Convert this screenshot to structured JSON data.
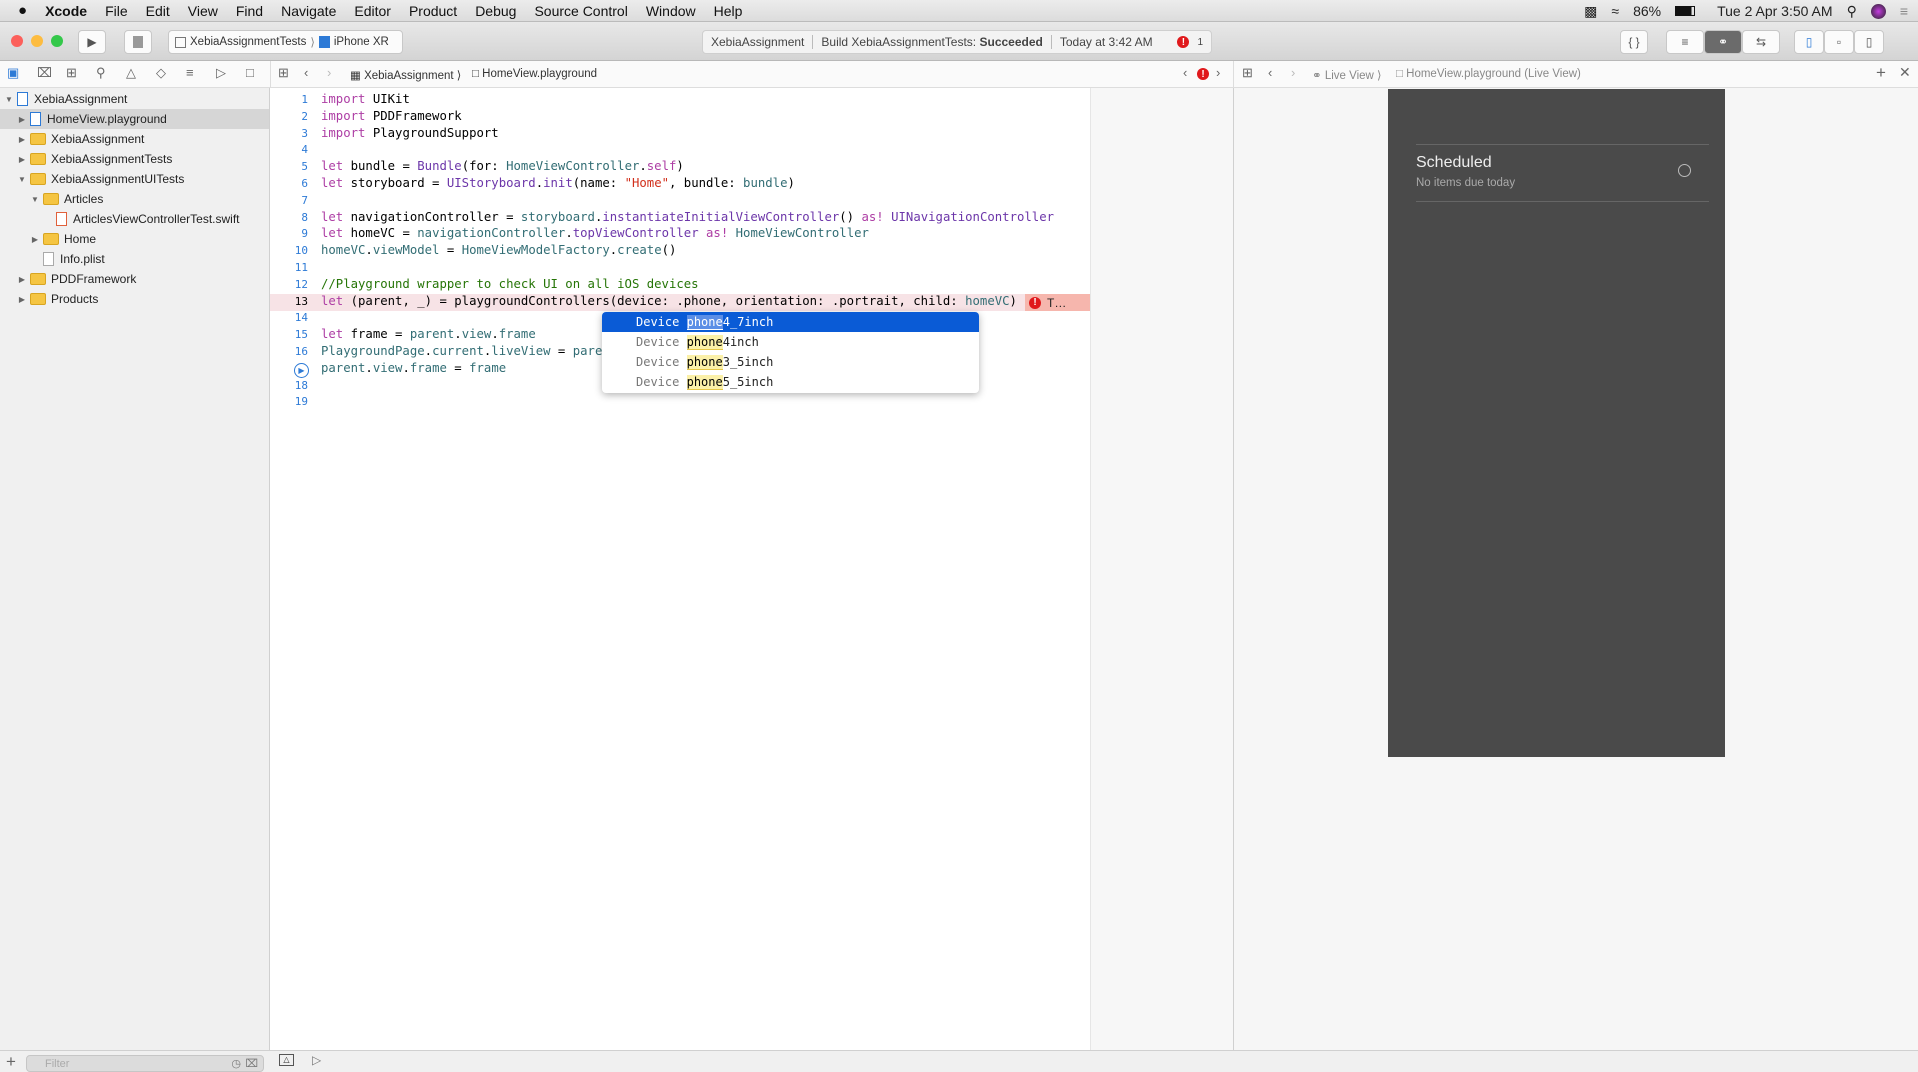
{
  "menubar": {
    "apple": "",
    "app": "Xcode",
    "items": [
      "File",
      "Edit",
      "View",
      "Find",
      "Navigate",
      "Editor",
      "Product",
      "Debug",
      "Source Control",
      "Window",
      "Help"
    ],
    "battery": "86%",
    "clock": "Tue 2 Apr  3:50 AM"
  },
  "toolbar": {
    "scheme": "XebiaAssignmentTests",
    "device": "iPhone XR",
    "activity": {
      "project": "XebiaAssignment",
      "build_prefix": "Build XebiaAssignmentTests:",
      "build_status": "Succeeded",
      "time": "Today at 3:42 AM",
      "error_count": "1"
    },
    "accent": "#0a5bd6"
  },
  "jumpbar": {
    "project": "XebiaAssignment",
    "file": "HomeView.playground"
  },
  "live_jumpbar": {
    "section": "Live View",
    "file": "HomeView.playground (Live View)"
  },
  "navigator": {
    "items": [
      {
        "label": "XebiaAssignment",
        "level": 0,
        "expanded": true,
        "kind": "project"
      },
      {
        "label": "HomeView.playground",
        "level": 1,
        "expanded": false,
        "kind": "playground",
        "selected": true
      },
      {
        "label": "XebiaAssignment",
        "level": 1,
        "expanded": false,
        "kind": "folder"
      },
      {
        "label": "XebiaAssignmentTests",
        "level": 1,
        "expanded": false,
        "kind": "folder"
      },
      {
        "label": "XebiaAssignmentUITests",
        "level": 1,
        "expanded": true,
        "kind": "folder"
      },
      {
        "label": "Articles",
        "level": 2,
        "expanded": true,
        "kind": "folder"
      },
      {
        "label": "ArticlesViewControllerTest.swift",
        "level": 3,
        "kind": "swift"
      },
      {
        "label": "Home",
        "level": 2,
        "expanded": false,
        "kind": "folder"
      },
      {
        "label": "Info.plist",
        "level": 2,
        "kind": "plist"
      },
      {
        "label": "PDDFramework",
        "level": 1,
        "expanded": false,
        "kind": "folder"
      },
      {
        "label": "Products",
        "level": 1,
        "expanded": false,
        "kind": "folder"
      }
    ],
    "filter_placeholder": "Filter"
  },
  "code": {
    "lines": [
      [
        [
          "import",
          "kw"
        ],
        [
          " UIKit",
          "pl"
        ]
      ],
      [
        [
          "import",
          "kw"
        ],
        [
          " PDDFramework",
          "pl"
        ]
      ],
      [
        [
          "import",
          "kw"
        ],
        [
          " PlaygroundSupport",
          "pl"
        ]
      ],
      [],
      [
        [
          "let",
          "kw"
        ],
        [
          " bundle = ",
          "pl"
        ],
        [
          "Bundle",
          "ty"
        ],
        [
          "(for: ",
          "pl"
        ],
        [
          "HomeViewController",
          "pr"
        ],
        [
          ".",
          "pl"
        ],
        [
          "self",
          "kw"
        ],
        [
          ")",
          "pl"
        ]
      ],
      [
        [
          "let",
          "kw"
        ],
        [
          " storyboard = ",
          "pl"
        ],
        [
          "UIStoryboard",
          "ty"
        ],
        [
          ".",
          "pl"
        ],
        [
          "init",
          "ty"
        ],
        [
          "(name: ",
          "pl"
        ],
        [
          "\"Home\"",
          "st"
        ],
        [
          ", bundle: ",
          "pl"
        ],
        [
          "bundle",
          "pr"
        ],
        [
          ")",
          "pl"
        ]
      ],
      [],
      [
        [
          "let",
          "kw"
        ],
        [
          " navigationController = ",
          "pl"
        ],
        [
          "storyboard",
          "pr"
        ],
        [
          ".",
          "pl"
        ],
        [
          "instantiateInitialViewController",
          "ty"
        ],
        [
          "() ",
          "pl"
        ],
        [
          "as!",
          "kw"
        ],
        [
          " ",
          "pl"
        ],
        [
          "UINavigationController",
          "ty"
        ]
      ],
      [
        [
          "let",
          "kw"
        ],
        [
          " homeVC = ",
          "pl"
        ],
        [
          "navigationController",
          "pr"
        ],
        [
          ".",
          "pl"
        ],
        [
          "topViewController",
          "ty"
        ],
        [
          " ",
          "pl"
        ],
        [
          "as!",
          "kw"
        ],
        [
          " ",
          "pl"
        ],
        [
          "HomeViewController",
          "pr"
        ]
      ],
      [
        [
          "homeVC",
          "pr"
        ],
        [
          ".",
          "pl"
        ],
        [
          "viewModel",
          "pr"
        ],
        [
          " = ",
          "pl"
        ],
        [
          "HomeViewModelFactory",
          "pr"
        ],
        [
          ".",
          "pl"
        ],
        [
          "create",
          "pr"
        ],
        [
          "()",
          "pl"
        ]
      ],
      [],
      [
        [
          "//Playground wrapper to check UI on all iOS devices",
          "cm"
        ]
      ],
      [
        [
          "let",
          "kw"
        ],
        [
          " (parent, _) = playgroundControllers(device: .phone, orientation: .portrait, child: ",
          "pl"
        ],
        [
          "homeVC",
          "pr"
        ],
        [
          ")",
          "pl"
        ]
      ],
      [],
      [
        [
          "let",
          "kw"
        ],
        [
          " frame = ",
          "pl"
        ],
        [
          "parent",
          "pr"
        ],
        [
          ".",
          "pl"
        ],
        [
          "view",
          "pr"
        ],
        [
          ".",
          "pl"
        ],
        [
          "frame",
          "pr"
        ]
      ],
      [
        [
          "PlaygroundPage",
          "pr"
        ],
        [
          ".",
          "pl"
        ],
        [
          "current",
          "pr"
        ],
        [
          ".",
          "pl"
        ],
        [
          "liveView",
          "pr"
        ],
        [
          " = ",
          "pl"
        ],
        [
          "pare",
          "pr"
        ]
      ],
      [
        [
          "parent",
          "pr"
        ],
        [
          ".",
          "pl"
        ],
        [
          "view",
          "pr"
        ],
        [
          ".",
          "pl"
        ],
        [
          "frame",
          "pr"
        ],
        [
          " = ",
          "pl"
        ],
        [
          "frame",
          "pr"
        ]
      ],
      [],
      []
    ],
    "error_line": 13,
    "error_text": "T…"
  },
  "autocomplete": {
    "items": [
      {
        "type": "Device",
        "match": "phone",
        "rest": "4_7inch",
        "selected": true
      },
      {
        "type": "Device",
        "match": "phone",
        "rest": "4inch"
      },
      {
        "type": "Device",
        "match": "phone",
        "rest": "3_5inch"
      },
      {
        "type": "Device",
        "match": "phone",
        "rest": "5_5inch"
      }
    ]
  },
  "live_view": {
    "title": "Scheduled",
    "subtitle": "No items due today",
    "icon": "alarm-clock-icon"
  }
}
